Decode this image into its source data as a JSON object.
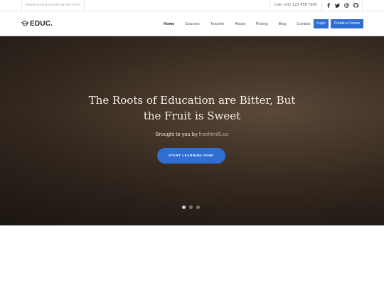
{
  "topbar": {
    "domain": "www.yourdomainname.com",
    "phone": "Call: +01 123 456 7890",
    "social_icons": [
      "facebook-icon",
      "twitter-icon",
      "pinterest-icon",
      "github-icon"
    ]
  },
  "nav": {
    "logo_text": "EDUC.",
    "items": [
      "Home",
      "Courses",
      "Teacher",
      "About",
      "Pricing",
      "Blog",
      "Contact"
    ],
    "active": "Home",
    "login_label": "Login",
    "create_label": "Create a Course"
  },
  "hero": {
    "title_line1": "The Roots of Education are Bitter, But",
    "title_line2": "the Fruit is Sweet",
    "subtitle_prefix": "Brought to you by ",
    "subtitle_link": "freehtml5.co",
    "cta_label": "START LEARNING NOW!",
    "slide_count": 3,
    "active_slide": 1
  },
  "colors": {
    "accent": "#2f6fd3",
    "hero_bg": "#3a2e24",
    "text_dark": "#222222"
  }
}
